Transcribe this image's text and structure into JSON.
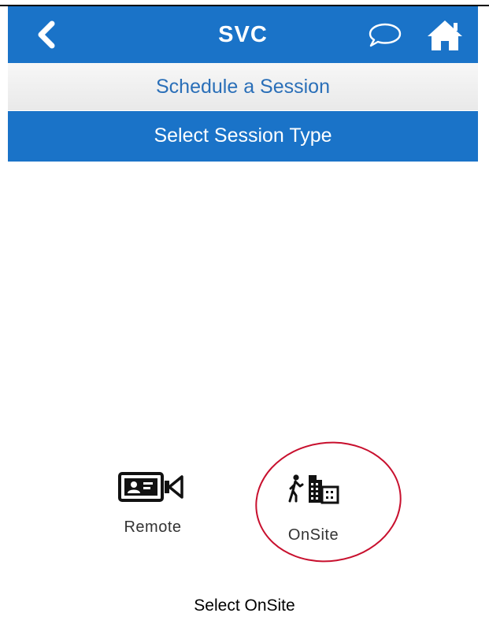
{
  "app_bar": {
    "title": "SVC",
    "back_icon": "chevron-left-icon",
    "chat_icon": "chat-bubble-icon",
    "home_icon": "home-icon",
    "color": "#1a73c8"
  },
  "subheader": {
    "label": "Schedule a Session"
  },
  "section": {
    "label": "Select Session Type"
  },
  "session_types": [
    {
      "label": "Remote",
      "icon": "video-call-icon"
    },
    {
      "label": "OnSite",
      "icon": "walk-to-building-icon"
    }
  ],
  "annotation": {
    "highlight_color": "#c8102e",
    "caption": "Select OnSite"
  }
}
